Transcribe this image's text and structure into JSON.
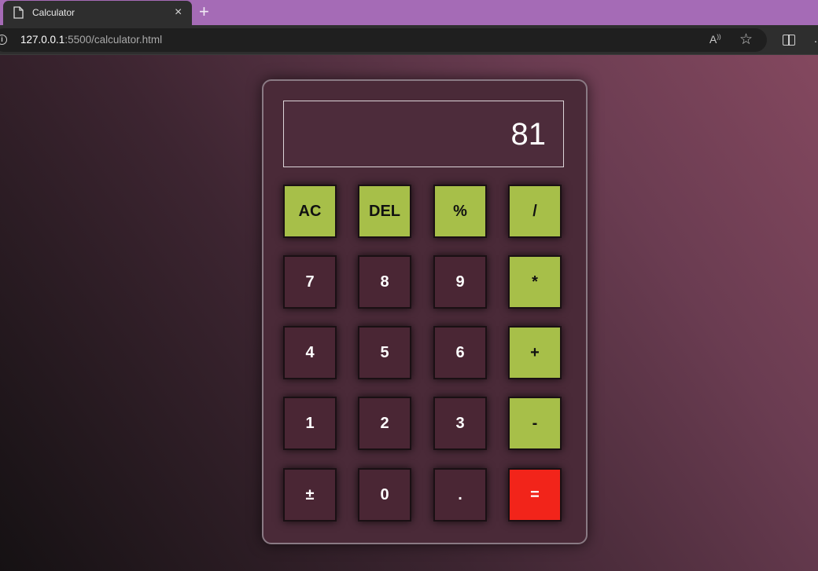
{
  "browser": {
    "tab_title": "Calculator",
    "tab_close": "×",
    "new_tab": "+",
    "url_host": "127.0.0.1",
    "url_rest": ":5500/calculator.html"
  },
  "calculator": {
    "display": "81",
    "keys": [
      [
        "AC",
        "DEL",
        "%",
        "/"
      ],
      [
        "7",
        "8",
        "9",
        "*"
      ],
      [
        "4",
        "5",
        "6",
        "+"
      ],
      [
        "1",
        "2",
        "3",
        "-"
      ],
      [
        "±",
        "0",
        ".",
        "="
      ]
    ]
  },
  "colors": {
    "operator_key": "#a7bf49",
    "equals_key": "#f2241a",
    "number_key": "#4a2634"
  }
}
